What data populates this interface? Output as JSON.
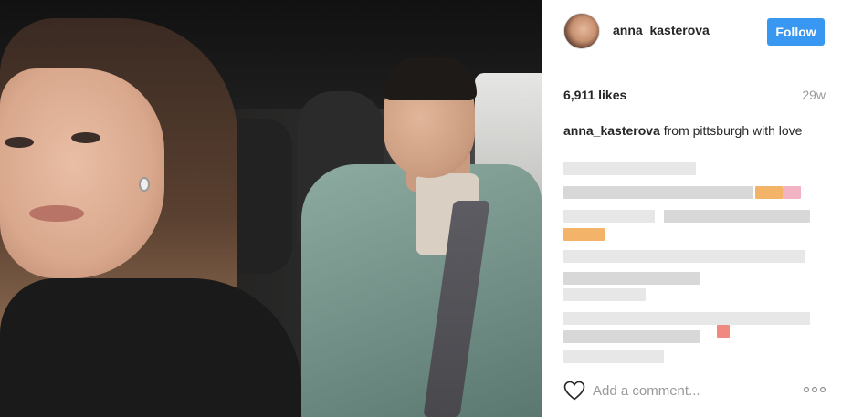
{
  "post": {
    "username": "anna_kasterova",
    "follow_label": "Follow",
    "likes": "6,911 likes",
    "time": "29w",
    "caption_user": "anna_kasterova",
    "caption_text": " from pittsburgh with love",
    "comments_state": "pixelated",
    "comment_placeholder": "Add a comment...",
    "icons": {
      "like": "heart-icon",
      "more": "more-options-icon",
      "avatar": "avatar"
    },
    "colors": {
      "follow_bg": "#3897f0",
      "time": "#999999"
    }
  }
}
